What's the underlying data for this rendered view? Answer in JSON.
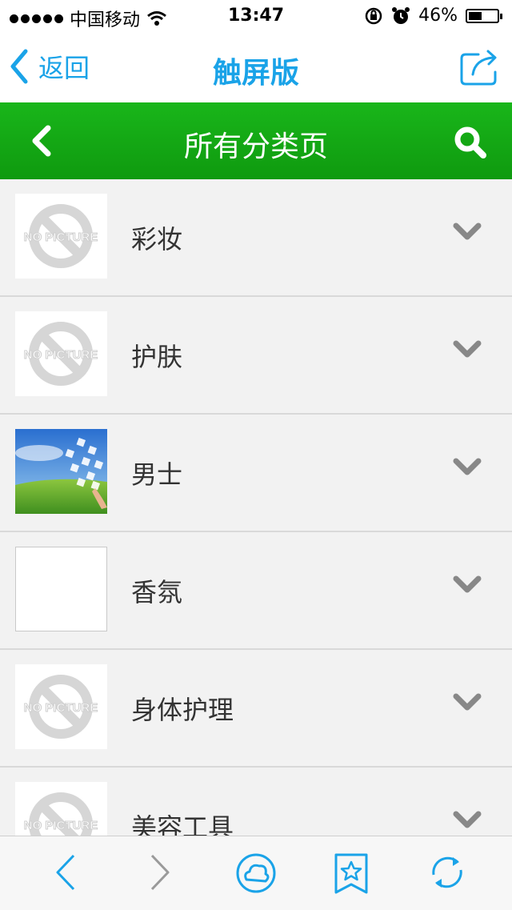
{
  "status_bar": {
    "carrier": "中国移动",
    "time": "13:47",
    "battery_text": "46%",
    "battery_level": 0.46
  },
  "browser": {
    "back_label": "返回",
    "title": "触屏版"
  },
  "header": {
    "title": "所有分类页"
  },
  "categories": [
    {
      "label": "彩妆",
      "thumb": "no-picture"
    },
    {
      "label": "护肤",
      "thumb": "no-picture"
    },
    {
      "label": "男士",
      "thumb": "photo"
    },
    {
      "label": "香氛",
      "thumb": "blank"
    },
    {
      "label": "身体护理",
      "thumb": "no-picture"
    },
    {
      "label": "美容工具",
      "thumb": "no-picture"
    }
  ],
  "no_picture_text": "NO PICTURE",
  "colors": {
    "accent_blue": "#1aa3e8",
    "header_green": "#14aa14",
    "chevron_gray": "#888888"
  },
  "icons": {
    "browser_back": "chevron-left-icon",
    "share": "share-icon",
    "header_back": "chevron-left-icon",
    "search": "search-icon",
    "expand": "chevron-down-icon",
    "toolbar": [
      "back-icon",
      "forward-icon",
      "cloud-icon",
      "bookmark-star-icon",
      "refresh-icon"
    ]
  }
}
